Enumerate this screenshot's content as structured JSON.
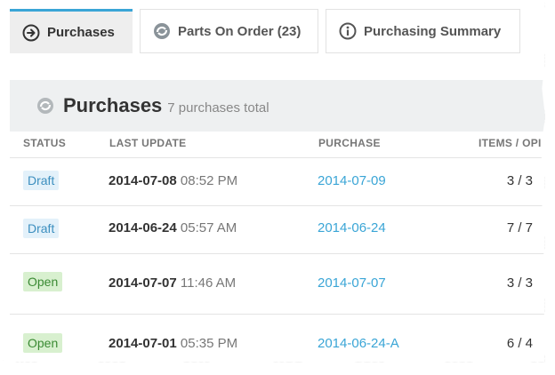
{
  "tabs": [
    {
      "label": "Purchases",
      "icon": "arrow-circle-icon",
      "active": true
    },
    {
      "label": "Parts On Order (23)",
      "icon": "refresh-icon",
      "active": false
    },
    {
      "label": "Purchasing Summary",
      "icon": "info-icon",
      "active": false
    }
  ],
  "section": {
    "title": "Purchases",
    "count_text": "7 purchases total"
  },
  "columns": {
    "status": "STATUS",
    "last_update": "LAST UPDATE",
    "purchase": "PURCHASE",
    "items": "ITEMS / OPI"
  },
  "rows": [
    {
      "status": "Draft",
      "date": "2014-07-08",
      "time": "08:52 PM",
      "purchase": "2014-07-09",
      "items": "3 / 3"
    },
    {
      "status": "Draft",
      "date": "2014-06-24",
      "time": "05:57 AM",
      "purchase": "2014-06-24",
      "items": "7 / 7"
    },
    {
      "status": "Open",
      "date": "2014-07-07",
      "time": "11:46 AM",
      "purchase": "2014-07-07",
      "items": "3 / 3"
    },
    {
      "status": "Open",
      "date": "2014-07-01",
      "time": "05:35 PM",
      "purchase": "2014-06-24-A",
      "items": "6 / 4"
    }
  ],
  "colors": {
    "accent": "#3aa5d6",
    "draft_bg": "#e3f1fa",
    "open_bg": "#d8f0cf"
  }
}
